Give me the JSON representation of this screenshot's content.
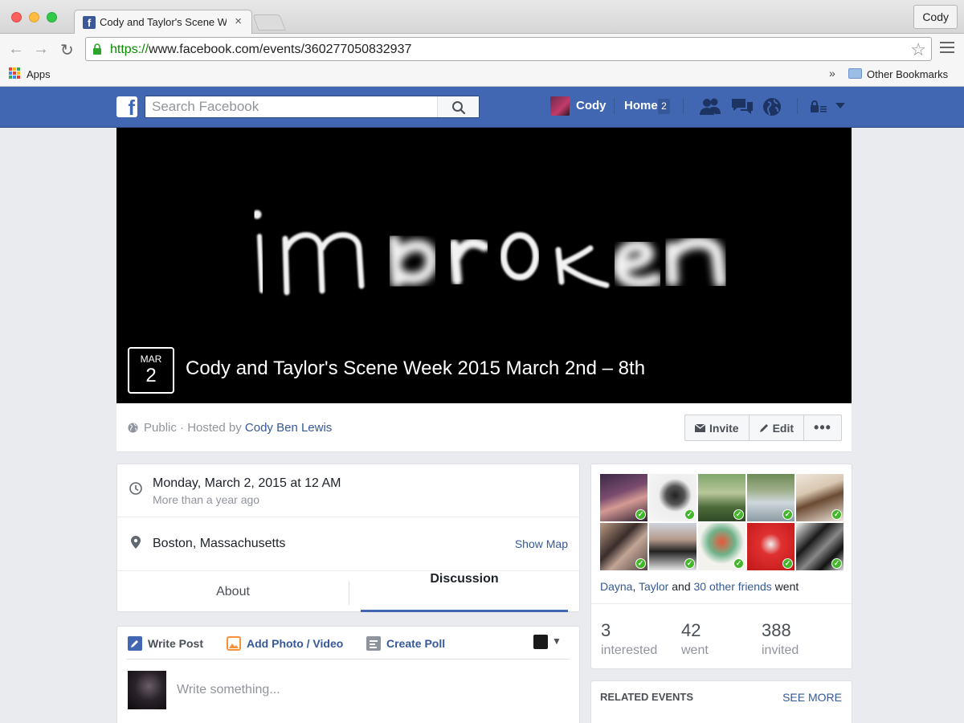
{
  "browser": {
    "tab_title": "Cody and Taylor's Scene W",
    "profile_name": "Cody",
    "url_protocol": "https://",
    "url_rest": "www.facebook.com/events/360277050832937",
    "bookmark_apps": "Apps",
    "bookmark_overflow": "»",
    "bookmark_other": "Other Bookmarks"
  },
  "fbbar": {
    "search_placeholder": "Search Facebook",
    "user_name": "Cody",
    "home_label": "Home",
    "home_count": "2"
  },
  "event": {
    "cover_text": "imbroken",
    "month": "MAR",
    "day": "2",
    "title": "Cody and Taylor's Scene Week 2015 March 2nd – 8th",
    "privacy": "Public",
    "hosted_by_prefix": " · Hosted by ",
    "host_name": "Cody Ben Lewis",
    "actions": {
      "invite": "Invite",
      "edit": "Edit",
      "more": "•••"
    }
  },
  "details": {
    "date": "Monday, March 2, 2015 at 12 AM",
    "date_relative": "More than a year ago",
    "location": "Boston, Massachusetts",
    "show_map": "Show Map",
    "tabs": [
      "About",
      "Discussion"
    ]
  },
  "composer": {
    "write_post": "Write Post",
    "add_photo": "Add Photo / Video",
    "create_poll": "Create Poll",
    "placeholder": "Write something..."
  },
  "guests": {
    "friend1": "Dayna",
    "sep": ", ",
    "friend2": "Taylor",
    "and": " and ",
    "others": "30 other friends",
    "went_suffix": " went",
    "stats": [
      {
        "value": "3",
        "label": "interested"
      },
      {
        "value": "42",
        "label": "went"
      },
      {
        "value": "388",
        "label": "invited"
      }
    ]
  },
  "related": {
    "title": "RELATED EVENTS",
    "see_more": "SEE MORE"
  },
  "colors": {
    "fb_blue": "#4267b2",
    "link": "#365899",
    "went_check": "#42b72a"
  }
}
